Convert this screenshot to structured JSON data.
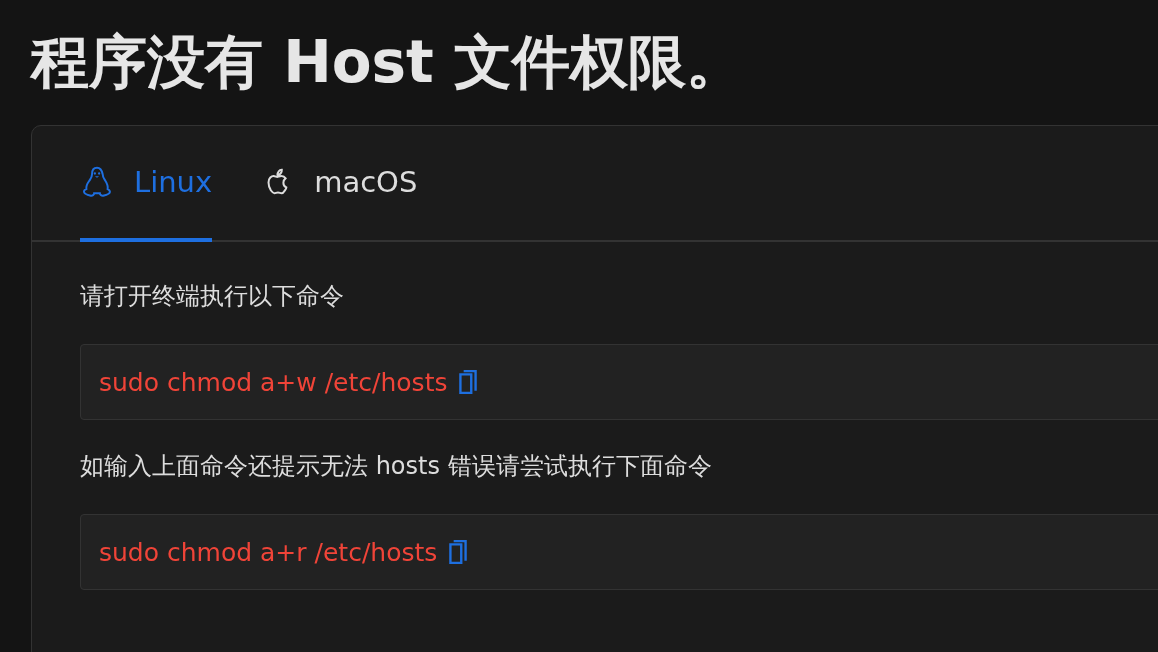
{
  "title": "程序没有 Host 文件权限。",
  "tabs": [
    {
      "label": "Linux",
      "kind": "penguin",
      "selected": true
    },
    {
      "label": "macOS",
      "kind": "apple",
      "selected": false
    }
  ],
  "content": [
    {
      "kind": "text",
      "text": "请打开终端执行以下命令"
    },
    {
      "kind": "code",
      "text": "sudo chmod a+w /etc/hosts"
    },
    {
      "kind": "text",
      "text": "如输入上面命令还提示无法 hosts 错误请尝试执行下面命令"
    },
    {
      "kind": "code",
      "text": "sudo chmod a+r /etc/hosts"
    }
  ]
}
